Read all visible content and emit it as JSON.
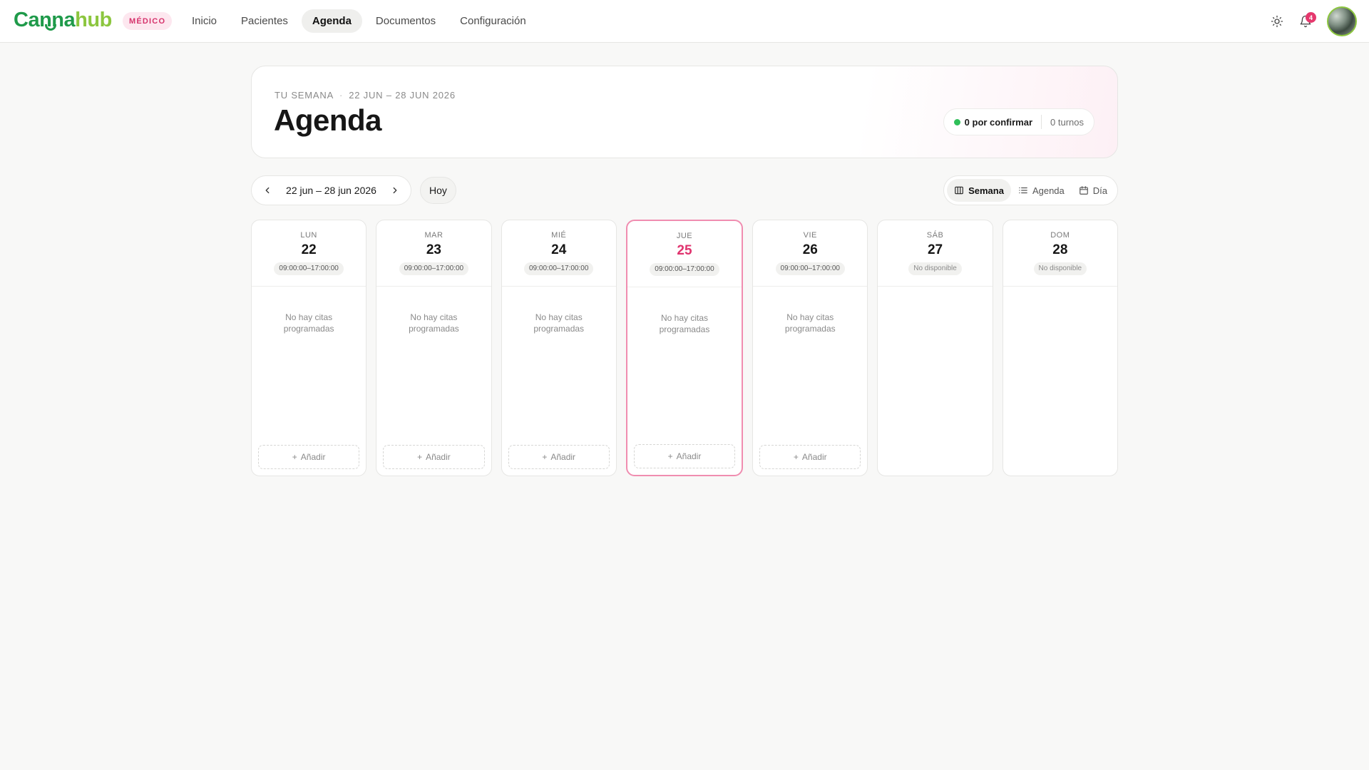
{
  "brand": {
    "name_part1": "Canna",
    "name_part2": "hub",
    "role": "MÉDICO"
  },
  "nav": [
    "Inicio",
    "Pacientes",
    "Agenda",
    "Documentos",
    "Configuración"
  ],
  "nav_active": "Agenda",
  "notifications": {
    "count": "4"
  },
  "header": {
    "eyebrow": "TU SEMANA",
    "range": "22 JUN – 28 JUN 2026",
    "title": "Agenda",
    "pending": "0 por confirmar",
    "turns": "0 turnos"
  },
  "toolbar": {
    "date_range": "22 jun – 28 jun 2026",
    "today": "Hoy",
    "views": [
      "Semana",
      "Agenda",
      "Día"
    ],
    "active_view": "Semana"
  },
  "days": [
    {
      "dow": "LUN",
      "num": "22",
      "hours": "09:00:00–17:00:00",
      "available": true,
      "empty": "No hay citas programadas",
      "add": "Añadir"
    },
    {
      "dow": "MAR",
      "num": "23",
      "hours": "09:00:00–17:00:00",
      "available": true,
      "empty": "No hay citas programadas",
      "add": "Añadir"
    },
    {
      "dow": "MIÉ",
      "num": "24",
      "hours": "09:00:00–17:00:00",
      "available": true,
      "empty": "No hay citas programadas",
      "add": "Añadir"
    },
    {
      "dow": "JUE",
      "num": "25",
      "hours": "09:00:00–17:00:00",
      "available": true,
      "today": true,
      "empty": "No hay citas programadas",
      "add": "Añadir"
    },
    {
      "dow": "VIE",
      "num": "26",
      "hours": "09:00:00–17:00:00",
      "available": true,
      "empty": "No hay citas programadas",
      "add": "Añadir"
    },
    {
      "dow": "SÁB",
      "num": "27",
      "hours": "No disponible",
      "available": false
    },
    {
      "dow": "DOM",
      "num": "28",
      "hours": "No disponible",
      "available": false
    }
  ],
  "colors": {
    "brand_green": "#1f9a4a",
    "brand_lime": "#8cc63f",
    "today_accent": "#e0336e",
    "status_green": "#2fbf59"
  },
  "icons": [
    "sun-icon",
    "bell-icon",
    "chevron-left-icon",
    "chevron-right-icon",
    "columns-icon",
    "list-icon",
    "calendar-icon",
    "plus-icon"
  ]
}
